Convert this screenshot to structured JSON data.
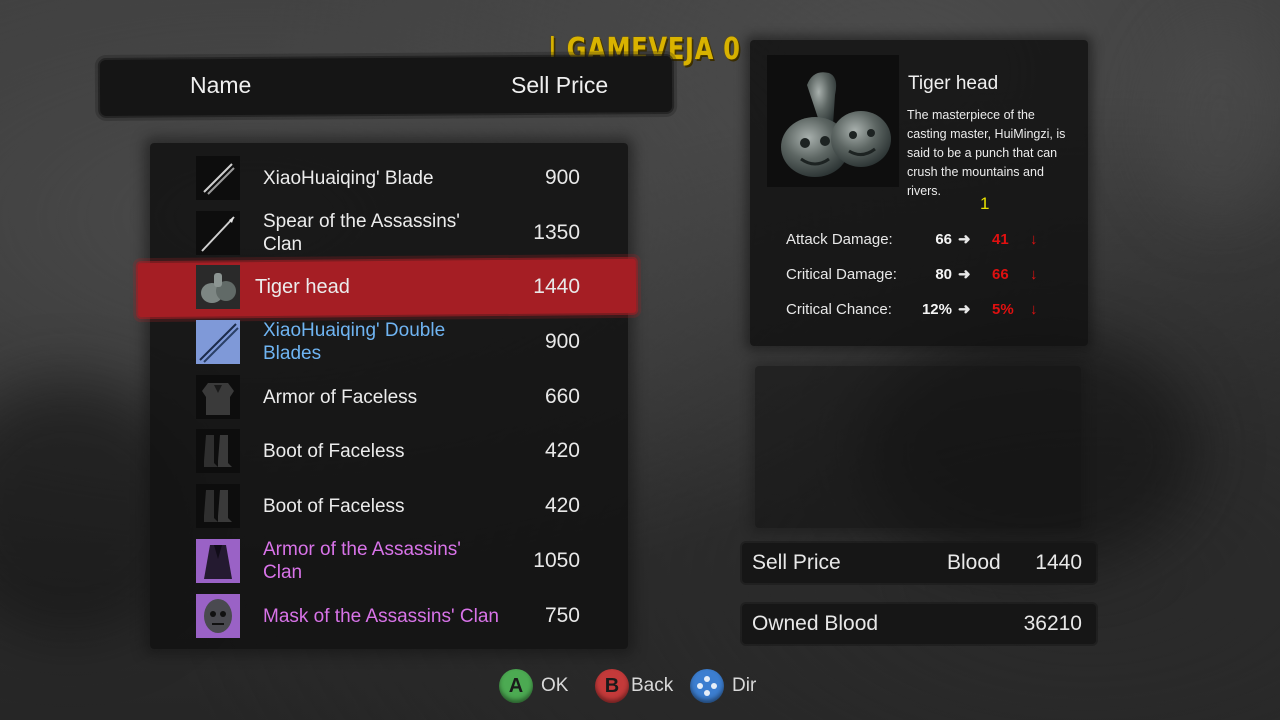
{
  "logo_text": "| GAMEVEJA 0",
  "header": {
    "name_label": "Name",
    "price_label": "Sell Price"
  },
  "items": [
    {
      "name": "XiaoHuaiqing' Blade",
      "price": "900",
      "color": "#ececec",
      "icon": "twin-blade-icon"
    },
    {
      "name": "Spear of the Assassins' Clan",
      "price": "1350",
      "color": "#ececec",
      "icon": "spear-icon"
    },
    {
      "name": "Tiger head",
      "price": "1440",
      "color": "#ececec",
      "icon": "tiger-fist-icon"
    },
    {
      "name": "XiaoHuaiqing' Double Blades",
      "price": "900",
      "color": "#6fb4f2",
      "icon": "double-blades-icon"
    },
    {
      "name": "Armor of Faceless",
      "price": "660",
      "color": "#ececec",
      "icon": "armor-icon"
    },
    {
      "name": "Boot of Faceless",
      "price": "420",
      "color": "#ececec",
      "icon": "boots-icon"
    },
    {
      "name": "Boot of Faceless",
      "price": "420",
      "color": "#ececec",
      "icon": "boots-icon"
    },
    {
      "name": "Armor of the Assassins' Clan",
      "price": "1050",
      "color": "#d873e8",
      "icon": "robe-icon"
    },
    {
      "name": "Mask of the Assassins' Clan",
      "price": "750",
      "color": "#d873e8",
      "icon": "mask-icon"
    }
  ],
  "selected_index": 2,
  "detail": {
    "title": "Tiger head",
    "description": "The masterpiece of the casting master, HuiMingzi, is said to be a punch that can crush the mountains and rivers.",
    "count": "1",
    "image_icon": "tiger-fist-icon",
    "stats": [
      {
        "label": "Attack Damage:",
        "old": "66",
        "new": "41"
      },
      {
        "label": "Critical Damage:",
        "old": "80",
        "new": "66"
      },
      {
        "label": "Critical Chance:",
        "old": "12%",
        "new": "5%"
      }
    ]
  },
  "sell_bar": {
    "label": "Sell Price",
    "currency": "Blood",
    "value": "1440"
  },
  "owned_bar": {
    "label": "Owned Blood",
    "value": "36210"
  },
  "buttons": [
    {
      "glyph": "A",
      "label": "OK",
      "color": "#4caa52",
      "icon": "a-button-icon"
    },
    {
      "glyph": "B",
      "label": "Back",
      "color": "#c43a3a",
      "icon": "b-button-icon"
    },
    {
      "glyph": "",
      "label": "Dir",
      "color": "#3c7ed0",
      "icon": "dpad-icon"
    }
  ],
  "colors": {
    "selection": "#a51e24",
    "decrease": "#e01010",
    "rare_blue": "#6fb4f2",
    "epic_purple": "#d873e8",
    "logo": "#d9b300"
  }
}
